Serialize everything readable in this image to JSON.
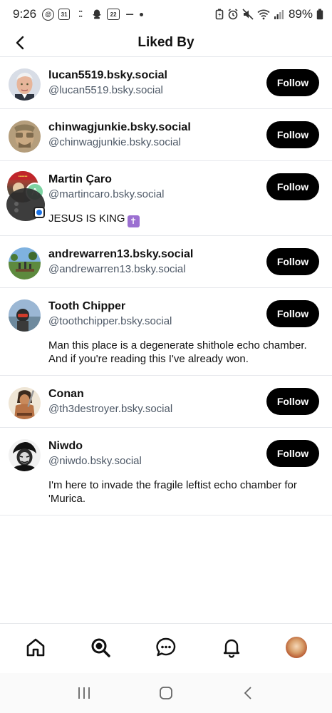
{
  "status_bar": {
    "time": "9:26",
    "calendar_date": "31",
    "notification_badge": "22",
    "battery": "89%"
  },
  "header": {
    "title": "Liked By"
  },
  "users": [
    {
      "name": "lucan5519.bsky.social",
      "handle": "@lucan5519.bsky.social",
      "bio": "",
      "follow_label": "Follow"
    },
    {
      "name": "chinwagjunkie.bsky.social",
      "handle": "@chinwagjunkie.bsky.social",
      "bio": "",
      "follow_label": "Follow"
    },
    {
      "name": "Martin Çaro",
      "handle": "@martincaro.bsky.social",
      "bio": "JESUS IS KING",
      "follow_label": "Follow",
      "account_initial": "A"
    },
    {
      "name": "andrewarren13.bsky.social",
      "handle": "@andrewarren13.bsky.social",
      "bio": "",
      "follow_label": "Follow"
    },
    {
      "name": "Tooth Chipper",
      "handle": "@toothchipper.bsky.social",
      "bio": "Man this place is a degenerate shithole echo chamber. And if you're reading this I've already won.",
      "follow_label": "Follow"
    },
    {
      "name": "Conan",
      "handle": "@th3destroyer.bsky.social",
      "bio": "",
      "follow_label": "Follow"
    },
    {
      "name": "Niwdo",
      "handle": "@niwdo.bsky.social",
      "bio": "I'm here to invade the fragile leftist echo chamber for 'Murica.",
      "follow_label": "Follow"
    }
  ],
  "tabs": [
    {
      "icon": "home-icon"
    },
    {
      "icon": "search-icon"
    },
    {
      "icon": "chat-icon"
    },
    {
      "icon": "bell-icon"
    },
    {
      "icon": "profile-avatar"
    }
  ],
  "colors": {
    "follow_button_bg": "#000000",
    "handle_text": "#4d5866",
    "divider": "#e6e8ec"
  }
}
